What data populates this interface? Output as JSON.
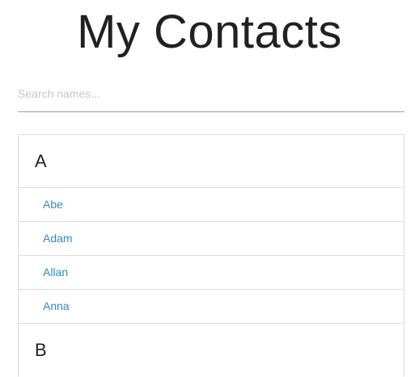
{
  "header": {
    "title": "My Contacts"
  },
  "search": {
    "placeholder": "Search names...",
    "value": ""
  },
  "groups": [
    {
      "letter": "A",
      "contacts": [
        "Abe",
        "Adam",
        "Allan",
        "Anna"
      ]
    },
    {
      "letter": "B",
      "contacts": []
    }
  ],
  "colors": {
    "link": "#2a8ccf",
    "title": "#212121",
    "border": "#dddddd"
  }
}
